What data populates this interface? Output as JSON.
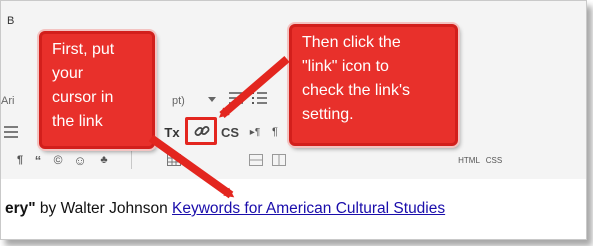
{
  "editor": {
    "tab_label": "B",
    "font_name": "Ari",
    "font_size_suffix": "pt)",
    "content": {
      "quote_fragment": "ery\"",
      "byline": " by Walter Johnson ",
      "link_text": "Keywords for American Cultural Studies"
    },
    "toolbar": {
      "remove_format_label": "Tx",
      "source_label": "CS",
      "html_label": "HTML",
      "css_label": "CSS"
    }
  },
  "callouts": {
    "first": "First, put\nyour\ncursor in\nthe link",
    "second": "Then click the\n\"link\" icon to\ncheck the link's\nsetting."
  },
  "colors": {
    "callout_red": "#e8302b",
    "link_blue": "#1a0dab"
  }
}
